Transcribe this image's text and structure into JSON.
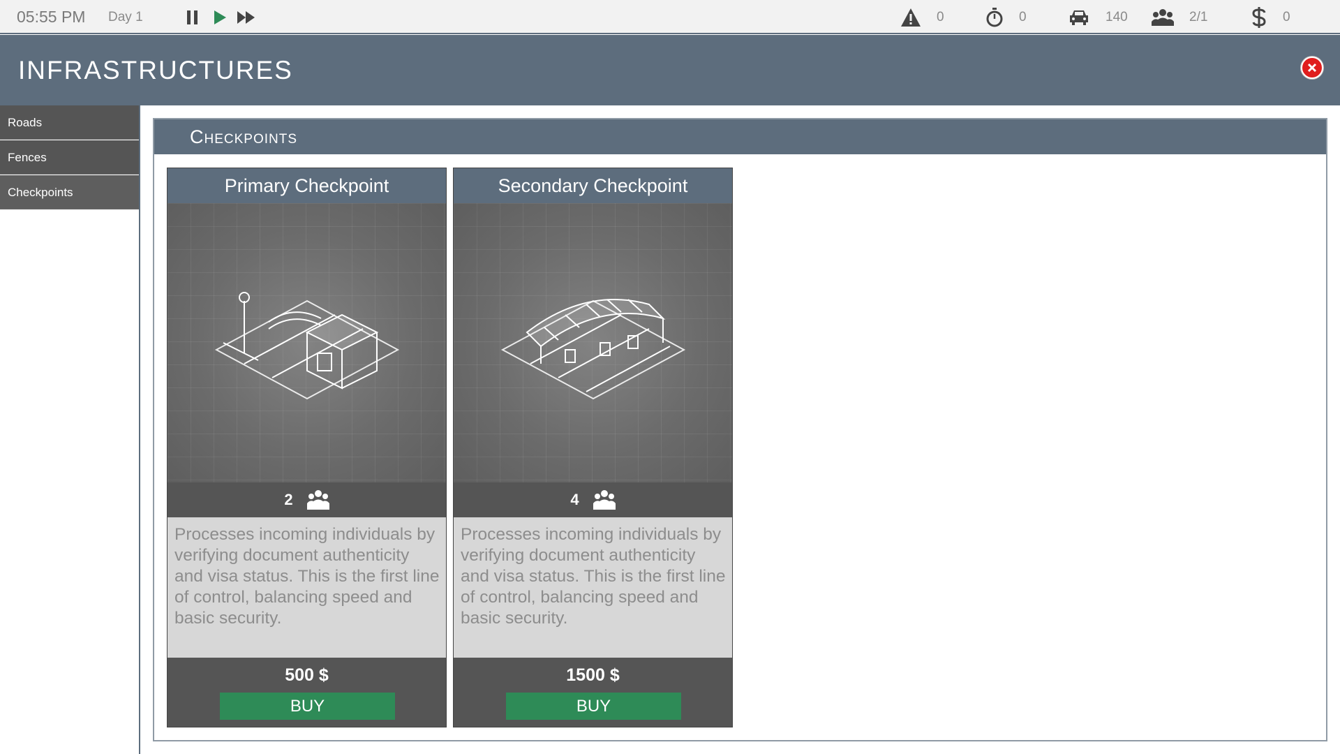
{
  "topbar": {
    "time": "05:55 PM",
    "day": "Day 1",
    "controls": [
      "pause",
      "play",
      "fast-forward"
    ],
    "stats": [
      {
        "icon": "warning-icon",
        "value": "0"
      },
      {
        "icon": "stopwatch-icon",
        "value": "0"
      },
      {
        "icon": "car-icon",
        "value": "140"
      },
      {
        "icon": "people-icon",
        "value": "2/1"
      },
      {
        "icon": "dollar-icon",
        "value": "0"
      }
    ]
  },
  "window": {
    "title": "INFRASTRUCTURES"
  },
  "sidebar": {
    "items": [
      {
        "label": "Roads"
      },
      {
        "label": "Fences"
      },
      {
        "label": "Checkpoints"
      }
    ]
  },
  "section": {
    "title": "Checkpoints"
  },
  "cards": [
    {
      "name": "Primary Checkpoint",
      "capacity": "2",
      "description": "Processes incoming individuals by verifying document authenticity and visa status. This is the first line of control, balancing speed and basic security.",
      "price": "500 $",
      "buy_label": "BUY"
    },
    {
      "name": "Secondary Checkpoint",
      "capacity": "4",
      "description": "Processes incoming individuals by verifying document authenticity and visa status. This is the first line of control, balancing speed and basic security.",
      "price": "1500 $",
      "buy_label": "BUY"
    }
  ],
  "colors": {
    "header": "#5d6d7d",
    "sidebar_item": "#555555",
    "buy_button": "#2e8b57",
    "close_button": "#e01e1e",
    "play_button": "#2e8b57"
  }
}
